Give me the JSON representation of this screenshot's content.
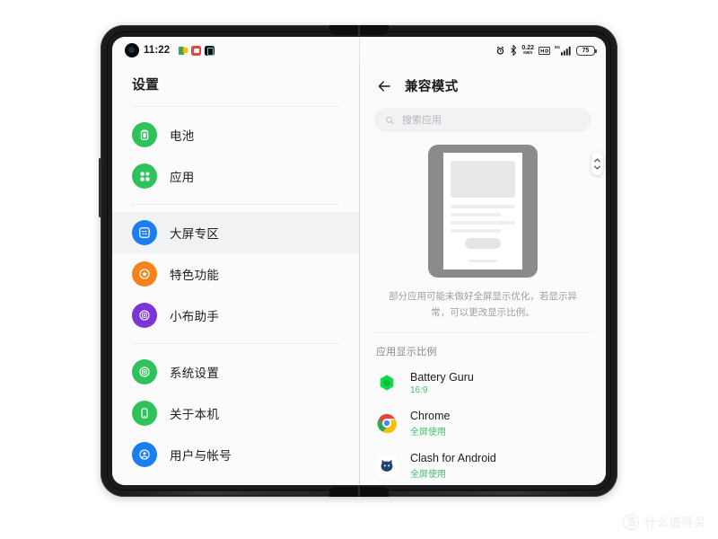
{
  "statusbar": {
    "time": "11:22",
    "notification_icons": [
      "slides-icon",
      "red-app-icon",
      "tiktok-icon"
    ],
    "right_icons": [
      "alarm-icon",
      "bluetooth-icon",
      "network-speed",
      "hd-icon",
      "signal-icon"
    ],
    "net_speed_value": "0.22",
    "net_speed_unit": "KB/S",
    "hd_label": "HD",
    "signal_label": "5G",
    "battery_percent": "75"
  },
  "sidebar": {
    "title": "设置",
    "groups": [
      {
        "items": [
          {
            "label": "电池",
            "icon": "battery-icon",
            "color": "#2fc25b",
            "selected": false
          },
          {
            "label": "应用",
            "icon": "apps-grid-icon",
            "color": "#2fc25b",
            "selected": false
          }
        ]
      },
      {
        "items": [
          {
            "label": "大屏专区",
            "icon": "large-screen-icon",
            "color": "#1a7ef0",
            "selected": true
          },
          {
            "label": "特色功能",
            "icon": "star-feature-icon",
            "color": "#f5811f",
            "selected": false
          },
          {
            "label": "小布助手",
            "icon": "assistant-icon",
            "color": "#7b35d6",
            "selected": false
          }
        ]
      },
      {
        "items": [
          {
            "label": "系统设置",
            "icon": "system-settings-icon",
            "color": "#2fc25b",
            "selected": false
          },
          {
            "label": "关于本机",
            "icon": "about-phone-icon",
            "color": "#2fc25b",
            "selected": false
          },
          {
            "label": "用户与帐号",
            "icon": "user-account-icon",
            "color": "#1a7ef0",
            "selected": false
          }
        ]
      }
    ]
  },
  "detail": {
    "back_label": "back-arrow",
    "title": "兼容模式",
    "search": {
      "placeholder": "搜索应用",
      "value": ""
    },
    "illustration_name": "compat-mode-illustration",
    "description": "部分应用可能未做好全屏显示优化，若显示异常，可以更改显示比例。",
    "section_title": "应用显示比例",
    "apps": [
      {
        "name": "Battery Guru",
        "mode": "16:9",
        "icon": "battery-guru-icon"
      },
      {
        "name": "Chrome",
        "mode": "全屏使用",
        "icon": "chrome-icon"
      },
      {
        "name": "Clash for Android",
        "mode": "全屏使用",
        "icon": "clash-cat-icon"
      }
    ],
    "scroll_pill": "scroll-indicator"
  },
  "watermark": {
    "logo_char": "值",
    "text": "什么值得买"
  },
  "colors": {
    "accent_blue": "#1a7ef0",
    "green": "#2fc25b",
    "mode_green": "#3ec26a",
    "orange": "#f5811f",
    "purple": "#7b35d6",
    "selected_bg": "#f1f2f4"
  }
}
